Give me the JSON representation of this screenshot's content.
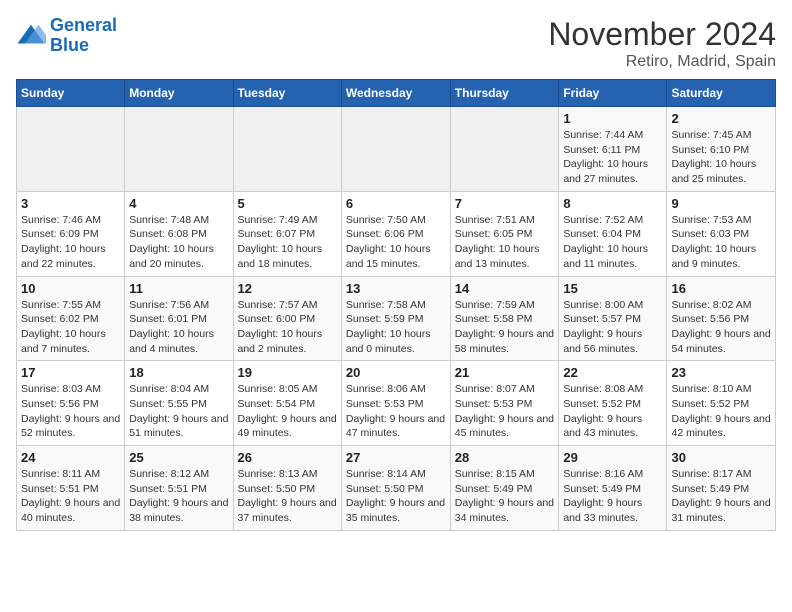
{
  "logo": {
    "text_general": "General",
    "text_blue": "Blue"
  },
  "title": "November 2024",
  "location": "Retiro, Madrid, Spain",
  "days_of_week": [
    "Sunday",
    "Monday",
    "Tuesday",
    "Wednesday",
    "Thursday",
    "Friday",
    "Saturday"
  ],
  "weeks": [
    [
      {
        "day": "",
        "info": ""
      },
      {
        "day": "",
        "info": ""
      },
      {
        "day": "",
        "info": ""
      },
      {
        "day": "",
        "info": ""
      },
      {
        "day": "",
        "info": ""
      },
      {
        "day": "1",
        "info": "Sunrise: 7:44 AM\nSunset: 6:11 PM\nDaylight: 10 hours and 27 minutes."
      },
      {
        "day": "2",
        "info": "Sunrise: 7:45 AM\nSunset: 6:10 PM\nDaylight: 10 hours and 25 minutes."
      }
    ],
    [
      {
        "day": "3",
        "info": "Sunrise: 7:46 AM\nSunset: 6:09 PM\nDaylight: 10 hours and 22 minutes."
      },
      {
        "day": "4",
        "info": "Sunrise: 7:48 AM\nSunset: 6:08 PM\nDaylight: 10 hours and 20 minutes."
      },
      {
        "day": "5",
        "info": "Sunrise: 7:49 AM\nSunset: 6:07 PM\nDaylight: 10 hours and 18 minutes."
      },
      {
        "day": "6",
        "info": "Sunrise: 7:50 AM\nSunset: 6:06 PM\nDaylight: 10 hours and 15 minutes."
      },
      {
        "day": "7",
        "info": "Sunrise: 7:51 AM\nSunset: 6:05 PM\nDaylight: 10 hours and 13 minutes."
      },
      {
        "day": "8",
        "info": "Sunrise: 7:52 AM\nSunset: 6:04 PM\nDaylight: 10 hours and 11 minutes."
      },
      {
        "day": "9",
        "info": "Sunrise: 7:53 AM\nSunset: 6:03 PM\nDaylight: 10 hours and 9 minutes."
      }
    ],
    [
      {
        "day": "10",
        "info": "Sunrise: 7:55 AM\nSunset: 6:02 PM\nDaylight: 10 hours and 7 minutes."
      },
      {
        "day": "11",
        "info": "Sunrise: 7:56 AM\nSunset: 6:01 PM\nDaylight: 10 hours and 4 minutes."
      },
      {
        "day": "12",
        "info": "Sunrise: 7:57 AM\nSunset: 6:00 PM\nDaylight: 10 hours and 2 minutes."
      },
      {
        "day": "13",
        "info": "Sunrise: 7:58 AM\nSunset: 5:59 PM\nDaylight: 10 hours and 0 minutes."
      },
      {
        "day": "14",
        "info": "Sunrise: 7:59 AM\nSunset: 5:58 PM\nDaylight: 9 hours and 58 minutes."
      },
      {
        "day": "15",
        "info": "Sunrise: 8:00 AM\nSunset: 5:57 PM\nDaylight: 9 hours and 56 minutes."
      },
      {
        "day": "16",
        "info": "Sunrise: 8:02 AM\nSunset: 5:56 PM\nDaylight: 9 hours and 54 minutes."
      }
    ],
    [
      {
        "day": "17",
        "info": "Sunrise: 8:03 AM\nSunset: 5:56 PM\nDaylight: 9 hours and 52 minutes."
      },
      {
        "day": "18",
        "info": "Sunrise: 8:04 AM\nSunset: 5:55 PM\nDaylight: 9 hours and 51 minutes."
      },
      {
        "day": "19",
        "info": "Sunrise: 8:05 AM\nSunset: 5:54 PM\nDaylight: 9 hours and 49 minutes."
      },
      {
        "day": "20",
        "info": "Sunrise: 8:06 AM\nSunset: 5:53 PM\nDaylight: 9 hours and 47 minutes."
      },
      {
        "day": "21",
        "info": "Sunrise: 8:07 AM\nSunset: 5:53 PM\nDaylight: 9 hours and 45 minutes."
      },
      {
        "day": "22",
        "info": "Sunrise: 8:08 AM\nSunset: 5:52 PM\nDaylight: 9 hours and 43 minutes."
      },
      {
        "day": "23",
        "info": "Sunrise: 8:10 AM\nSunset: 5:52 PM\nDaylight: 9 hours and 42 minutes."
      }
    ],
    [
      {
        "day": "24",
        "info": "Sunrise: 8:11 AM\nSunset: 5:51 PM\nDaylight: 9 hours and 40 minutes."
      },
      {
        "day": "25",
        "info": "Sunrise: 8:12 AM\nSunset: 5:51 PM\nDaylight: 9 hours and 38 minutes."
      },
      {
        "day": "26",
        "info": "Sunrise: 8:13 AM\nSunset: 5:50 PM\nDaylight: 9 hours and 37 minutes."
      },
      {
        "day": "27",
        "info": "Sunrise: 8:14 AM\nSunset: 5:50 PM\nDaylight: 9 hours and 35 minutes."
      },
      {
        "day": "28",
        "info": "Sunrise: 8:15 AM\nSunset: 5:49 PM\nDaylight: 9 hours and 34 minutes."
      },
      {
        "day": "29",
        "info": "Sunrise: 8:16 AM\nSunset: 5:49 PM\nDaylight: 9 hours and 33 minutes."
      },
      {
        "day": "30",
        "info": "Sunrise: 8:17 AM\nSunset: 5:49 PM\nDaylight: 9 hours and 31 minutes."
      }
    ]
  ]
}
